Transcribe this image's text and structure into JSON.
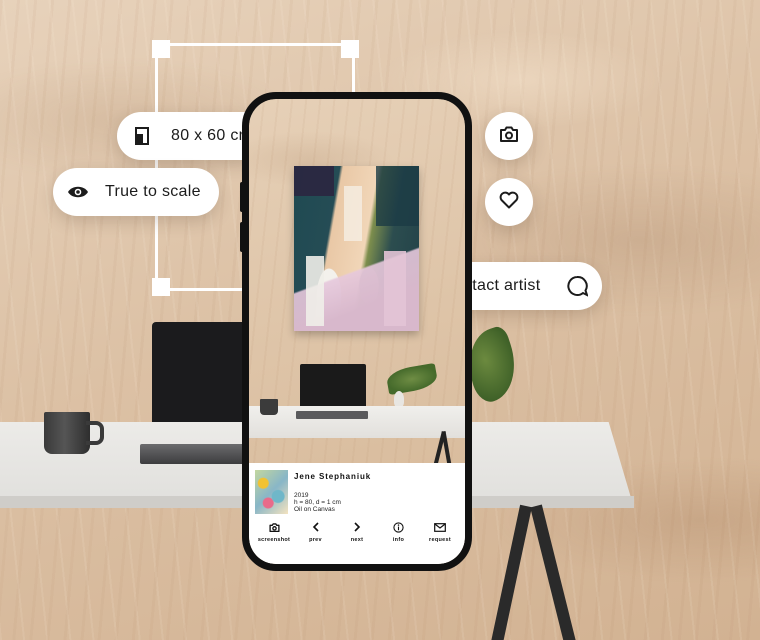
{
  "overlay": {
    "size_label": "80 x 60 cm",
    "scale_label": "True to scale",
    "contact_label": "Contact artist",
    "camera_icon": "camera-icon",
    "heart_icon": "heart-icon",
    "ruler_icon": "frame-size-icon",
    "eye_icon": "eye-icon",
    "chat_icon": "chat-bubble-icon"
  },
  "artwork_info": {
    "artist": "Jene Stephaniuk",
    "year": "2019",
    "dimensions": "h = 80, d = 1 cm",
    "medium": "Oil on Canvas"
  },
  "toolbar": {
    "items": [
      {
        "label": "screenshot",
        "icon": "camera-icon"
      },
      {
        "label": "prev",
        "icon": "chevron-left-icon"
      },
      {
        "label": "next",
        "icon": "chevron-right-icon"
      },
      {
        "label": "info",
        "icon": "info-icon"
      },
      {
        "label": "request",
        "icon": "envelope-icon"
      }
    ]
  }
}
